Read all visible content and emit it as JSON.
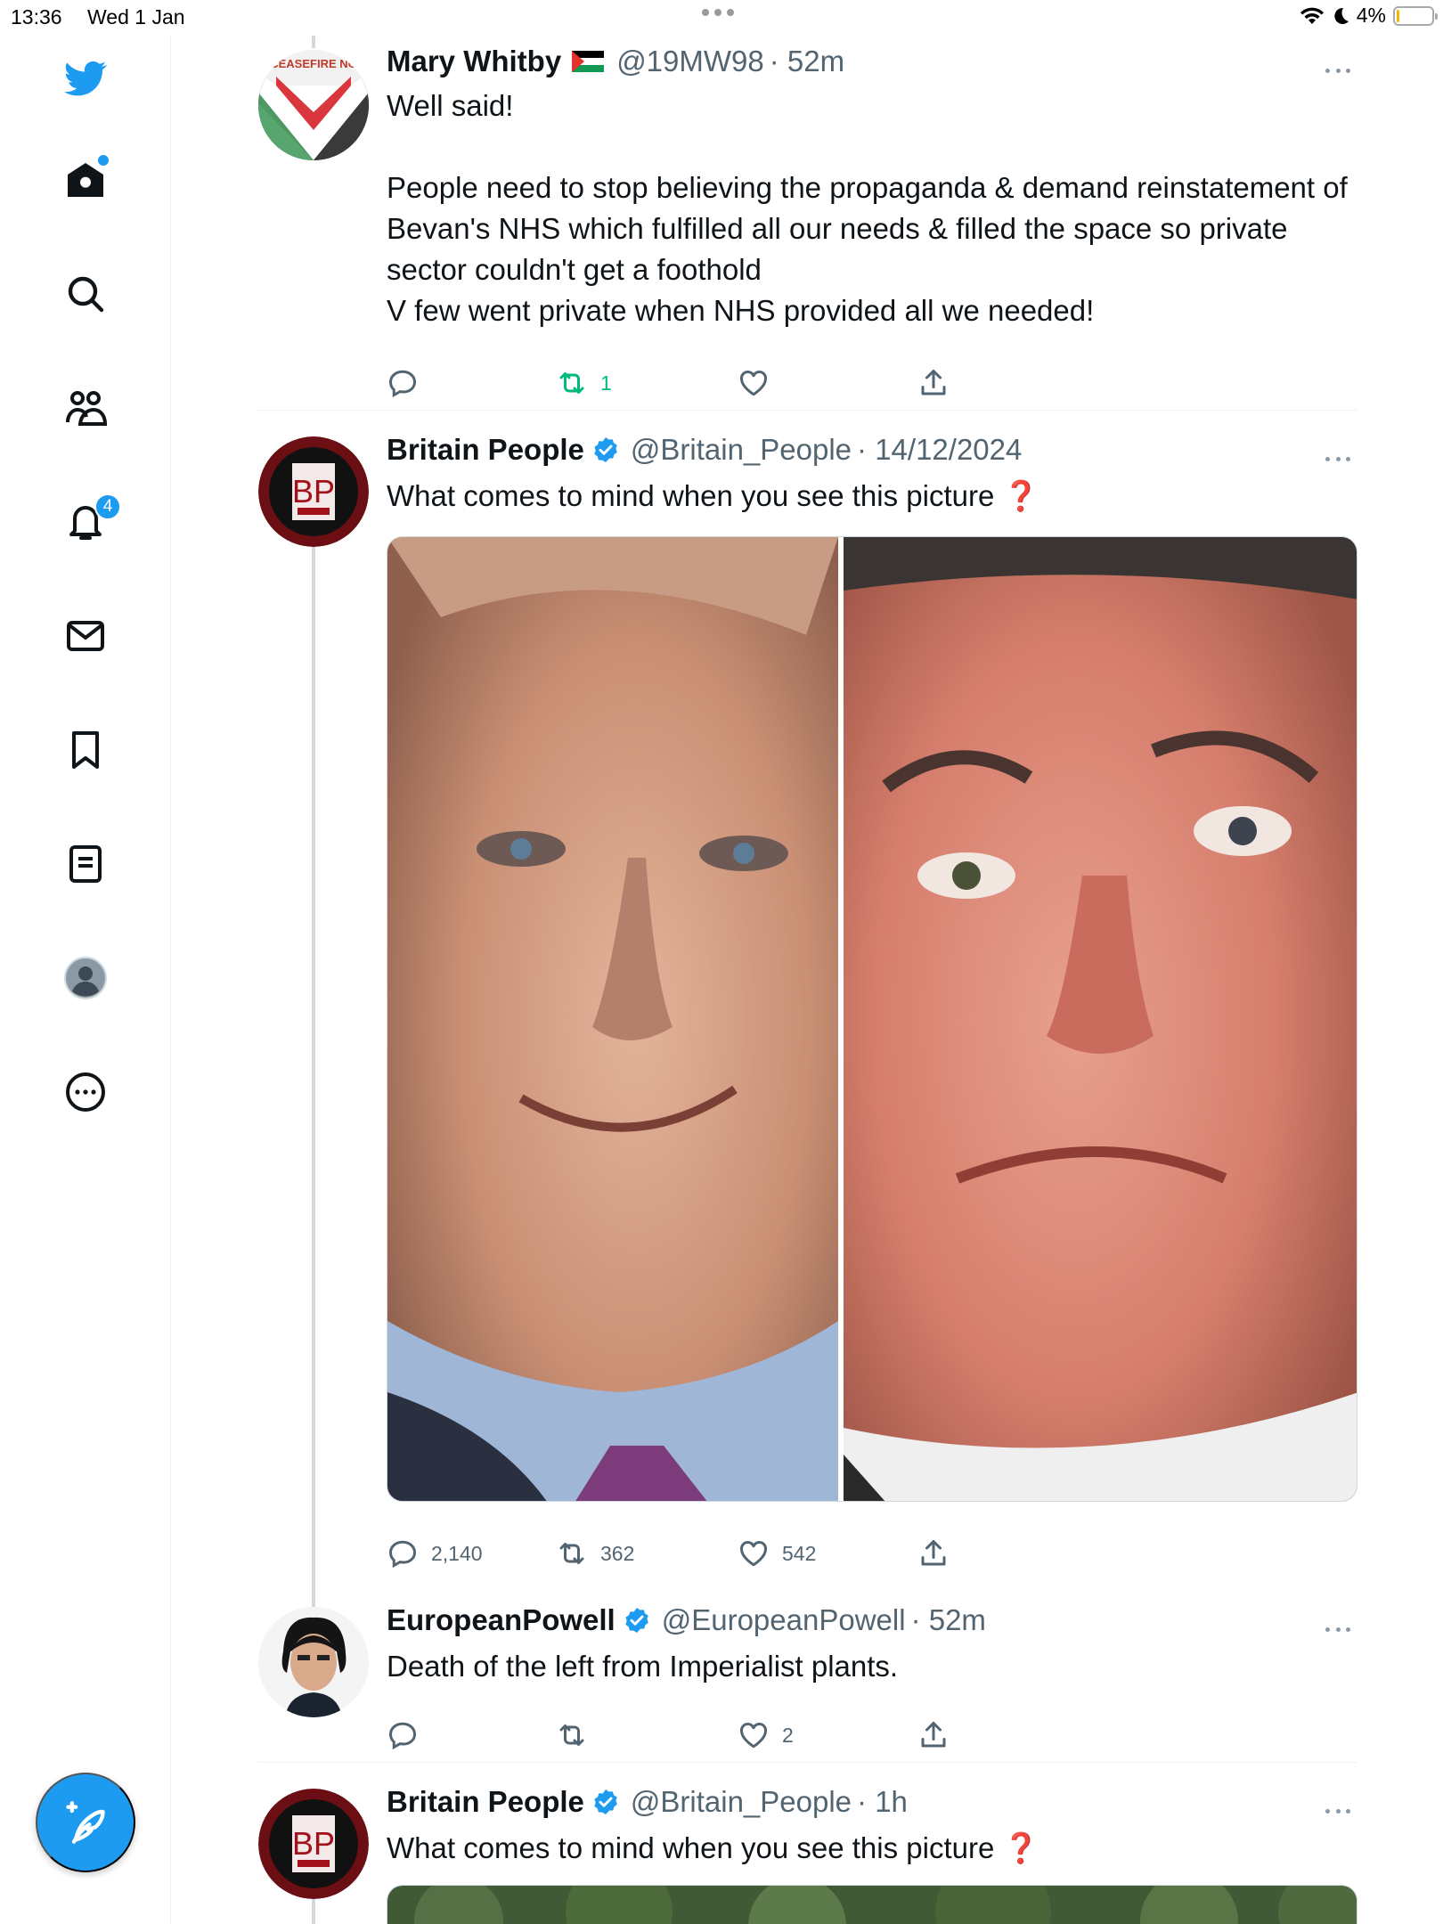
{
  "status_bar": {
    "time": "13:36",
    "date": "Wed 1 Jan",
    "battery": "4%"
  },
  "sidebar": {
    "items": [
      {
        "name": "twitter-logo-icon"
      },
      {
        "name": "home-icon"
      },
      {
        "name": "search-icon"
      },
      {
        "name": "communities-icon"
      },
      {
        "name": "notifications-icon",
        "badge": "4"
      },
      {
        "name": "messages-icon"
      },
      {
        "name": "bookmarks-icon"
      },
      {
        "name": "lists-icon"
      },
      {
        "name": "profile-avatar-icon"
      },
      {
        "name": "more-icon"
      }
    ],
    "compose_icon": "compose-feather-icon"
  },
  "colors": {
    "accent": "#1d9bf0",
    "retweet_active": "#00ba7c",
    "secondary_text": "#536471"
  },
  "tweets": [
    {
      "name": "Mary Whitby",
      "flag": "palestine-flag-icon",
      "handle": "@19MW98",
      "time": "· 52m",
      "text": "Well said!\n\nPeople need to stop believing the propaganda & demand reinstatement of Bevan's NHS which fulfilled all our needs & filled the space so private sector couldn't get a foothold\nV few went private when NHS provided all we needed!",
      "avatar_text": "CEASEFIRE NO",
      "replies": "",
      "retweets": "1",
      "likes": "",
      "retweeted": true
    },
    {
      "name": "Britain People",
      "verified": true,
      "handle": "@Britain_People",
      "time": "· 14/12/2024",
      "text": "What comes to mind when you see this picture ❓",
      "avatar_text": "BP",
      "media": "two-faces-side-by-side-photo",
      "replies": "2,140",
      "retweets": "362",
      "likes": "542"
    },
    {
      "name": "EuropeanPowell",
      "verified": true,
      "handle": "@EuropeanPowell",
      "time": "· 52m",
      "text": "Death of the left from Imperialist plants.",
      "replies": "",
      "retweets": "",
      "likes": "2"
    },
    {
      "name": "Britain People",
      "verified": true,
      "handle": "@Britain_People",
      "time": "· 1h",
      "text": "What comes to mind when you see this picture ❓",
      "avatar_text": "BP",
      "media": "trees-photo"
    }
  ]
}
